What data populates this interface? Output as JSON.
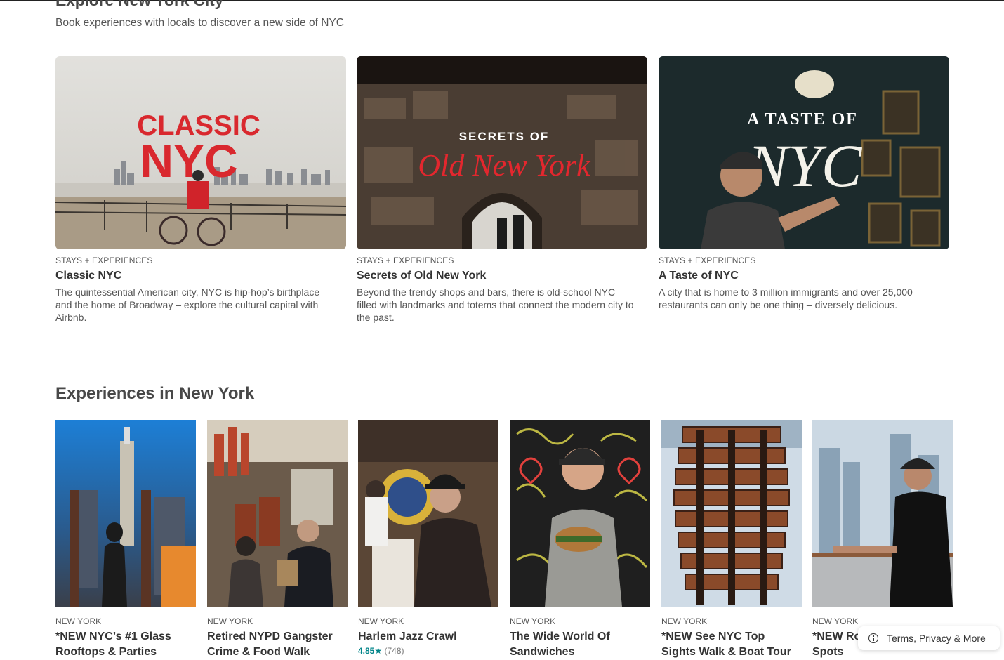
{
  "explore": {
    "title": "Explore New York City",
    "subtitle": "Book experiences with locals to discover a new side of NYC"
  },
  "features": [
    {
      "kicker": "STAYS + EXPERIENCES",
      "name": "Classic NYC",
      "description": "The quintessential American city, NYC is hip-hop’s birthplace and the home of Broadway – explore the cultural capital with Airbnb.",
      "image_text": [
        "CLASSIC",
        "NYC"
      ]
    },
    {
      "kicker": "STAYS + EXPERIENCES",
      "name": "Secrets of Old New York",
      "description": "Beyond the trendy shops and bars, there is old-school NYC – filled with landmarks and totems that connect the modern city to the past.",
      "image_text": [
        "SECRETS OF",
        "Old New York"
      ]
    },
    {
      "kicker": "STAYS + EXPERIENCES",
      "name": "A Taste of NYC",
      "description": "A city that is home to 3 million immigrants and over 25,000 restaurants can only be one thing – diversely delicious.",
      "image_text": [
        "A TASTE OF",
        "NYC"
      ]
    }
  ],
  "experiences_section": {
    "heading": "Experiences in New York",
    "items": [
      {
        "kicker": "NEW YORK",
        "name": "*NEW NYC’s #1 Glass Rooftops & Parties"
      },
      {
        "kicker": "NEW YORK",
        "name": "Retired NYPD Gangster Crime & Food Walk"
      },
      {
        "kicker": "NEW YORK",
        "name": "Harlem Jazz Crawl",
        "rating": "4.85",
        "star": "★",
        "reviews": "(748)"
      },
      {
        "kicker": "NEW YORK",
        "name": "The Wide World Of Sandwiches"
      },
      {
        "kicker": "NEW YORK",
        "name": "*NEW See NYC Top Sights Walk & Boat Tour"
      },
      {
        "kicker": "NEW YORK",
        "name": "*NEW Rooftop Photo Spots"
      }
    ]
  },
  "footer": {
    "terms_label": "Terms, Privacy & More",
    "info_icon": "info-icon"
  },
  "colors": {
    "rating": "#008489",
    "logo_red": "#d9282e",
    "text": "#484848"
  }
}
